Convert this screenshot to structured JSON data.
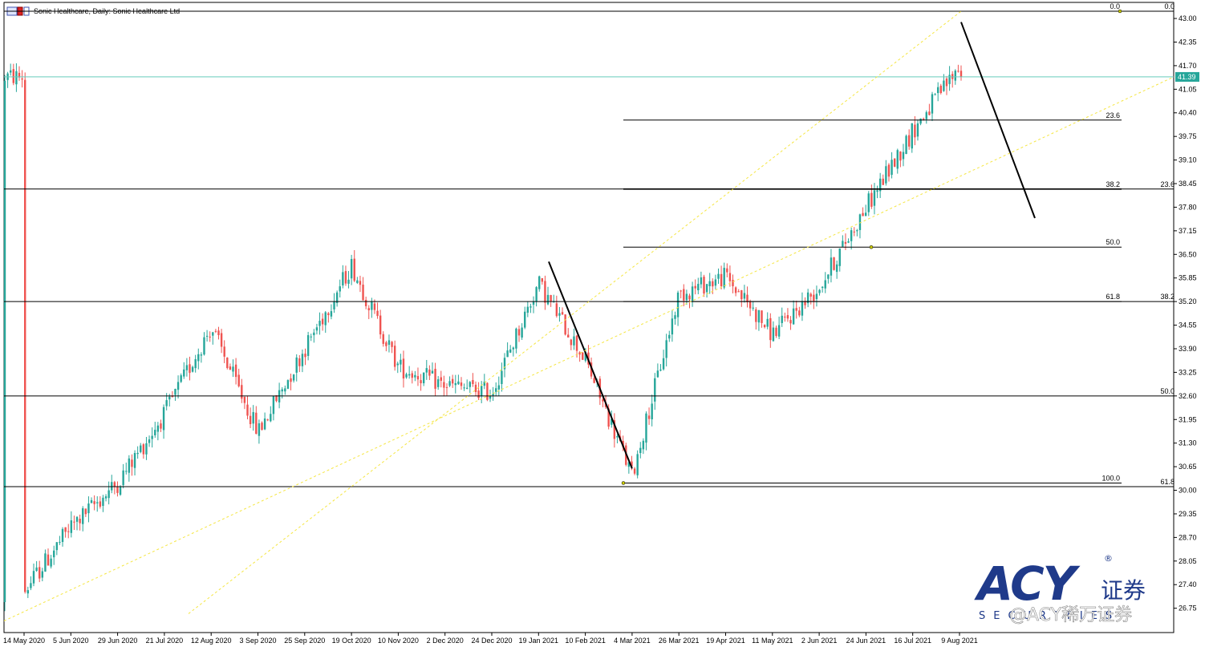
{
  "window": {
    "title": "Sonic Healthcare, Daily:  Sonic Healthcare Ltd"
  },
  "colors": {
    "bull": "#26a69a",
    "bear": "#ef5350",
    "price_line": "#66ccbb",
    "trend": "#f5e642",
    "level": "#000000",
    "price_tag_bg": "#26a69a"
  },
  "chart_data": {
    "type": "candlestick",
    "symbol": "Sonic Healthcare",
    "timeframe": "Daily",
    "ylim": [
      26.7,
      43.45
    ],
    "y_ticks": [
      "43.00",
      "42.35",
      "41.70",
      "41.05",
      "40.40",
      "39.75",
      "39.10",
      "38.45",
      "37.80",
      "37.15",
      "36.50",
      "35.85",
      "35.20",
      "34.55",
      "33.90",
      "33.25",
      "32.60",
      "31.95",
      "31.30",
      "30.65",
      "30.00",
      "29.35",
      "28.70",
      "28.05",
      "27.40",
      "26.75"
    ],
    "x_ticks": [
      "14 May 2020",
      "5 Jun 2020",
      "29 Jun 2020",
      "21 Jul 2020",
      "12 Aug 2020",
      "3 Sep 2020",
      "25 Sep 2020",
      "19 Oct 2020",
      "10 Nov 2020",
      "2 Dec 2020",
      "24 Dec 2020",
      "19 Jan 2021",
      "10 Feb 2021",
      "4 Mar 2021",
      "26 Mar 2021",
      "19 Apr 2021",
      "11 May 2021",
      "2 Jun 2021",
      "24 Jun 2021",
      "16 Jul 2021",
      "9 Aug 2021"
    ],
    "current_price": "41.39",
    "current_price_value": 41.39,
    "anchors": [
      {
        "date": "14 May 2020",
        "close": 27.2
      },
      {
        "date": "5 Jun 2020",
        "close": 29.0
      },
      {
        "date": "29 Jun 2020",
        "close": 30.2
      },
      {
        "date": "21 Jul 2020",
        "close": 32.1
      },
      {
        "date": "12 Aug 2020",
        "close": 34.5
      },
      {
        "date": "3 Sep 2020",
        "close": 31.6
      },
      {
        "date": "25 Sep 2020",
        "close": 33.9
      },
      {
        "date": "19 Oct 2020",
        "close": 36.2
      },
      {
        "date": "10 Nov 2020",
        "close": 33.4
      },
      {
        "date": "2 Dec 2020",
        "close": 32.9
      },
      {
        "date": "24 Dec 2020",
        "close": 32.7
      },
      {
        "date": "19 Jan 2021",
        "close": 35.7
      },
      {
        "date": "10 Feb 2021",
        "close": 33.6
      },
      {
        "date": "4 Mar 2021",
        "close": 30.4
      },
      {
        "date": "26 Mar 2021",
        "close": 35.4
      },
      {
        "date": "19 Apr 2021",
        "close": 35.9
      },
      {
        "date": "11 May 2021",
        "close": 34.3
      },
      {
        "date": "2 Jun 2021",
        "close": 35.6
      },
      {
        "date": "24 Jun 2021",
        "close": 37.8
      },
      {
        "date": "16 Jul 2021",
        "close": 39.9
      },
      {
        "date": "9 Aug 2021",
        "close": 41.7
      },
      {
        "date": "16 Aug 2021",
        "close": 41.39
      }
    ],
    "fib_retracement_1": {
      "from": {
        "date": "4 Mar 2021",
        "value": 30.2
      },
      "to": {
        "date": "17 Aug 2021",
        "value": 43.2
      },
      "levels": [
        {
          "label": "0.0",
          "value": 43.2
        },
        {
          "label": "23.6",
          "value": 40.2
        },
        {
          "label": "38.2",
          "value": 38.3
        },
        {
          "label": "50.0",
          "value": 36.7
        },
        {
          "label": "61.8",
          "value": 35.2
        },
        {
          "label": "100.0",
          "value": 30.2
        }
      ]
    },
    "fib_retracement_2": {
      "levels": [
        {
          "label": "0.0",
          "value": 43.2
        },
        {
          "label": "23.6",
          "value": 38.3
        },
        {
          "label": "38.2",
          "value": 35.2
        },
        {
          "label": "50.0",
          "value": 32.6
        },
        {
          "label": "61.8",
          "value": 30.1
        }
      ]
    },
    "trend_lines": [
      {
        "name": "drop-swing-line",
        "from": {
          "date": "21 Jan 2021",
          "value": 36.3
        },
        "to": {
          "date": "4 Mar 2021",
          "value": 30.6
        }
      },
      {
        "name": "projection-line",
        "from": {
          "date": "17 Aug 2021",
          "value": 42.9
        },
        "to": {
          "date": "8 Sep 2021",
          "value": 37.5
        }
      },
      {
        "name": "uptrend-line-1",
        "from": {
          "date": "12 Aug 2020",
          "value": 26.6
        },
        "to": {
          "date": "17 Aug 2021",
          "value": 43.2
        }
      },
      {
        "name": "uptrend-line-2",
        "from": {
          "date": "14 May 2020",
          "value": 26.4
        },
        "to": {
          "date": "17 Aug 2021",
          "value": 41.39
        }
      }
    ]
  },
  "watermark": {
    "brand": "ACY",
    "registered": "®",
    "cn_label": "证券",
    "sub_label": "SECURITIES",
    "social_handle": "@ACY稀万证券"
  }
}
